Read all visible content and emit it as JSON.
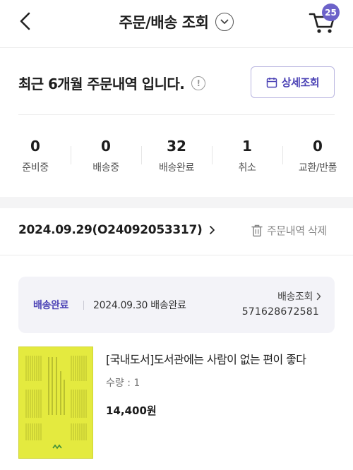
{
  "header": {
    "title": "주문/배송 조회",
    "cart_count": "25",
    "back_icon": "chevron-left-icon",
    "dropdown_icon": "chevron-down-icon",
    "cart_icon": "cart-icon"
  },
  "summary": {
    "title": "최근 6개월 주문내역 입니다.",
    "info_icon_glyph": "!",
    "detail_button_label": "상세조회",
    "detail_button_icon": "calendar-icon"
  },
  "stats": [
    {
      "count": "0",
      "label": "준비중"
    },
    {
      "count": "0",
      "label": "배송중"
    },
    {
      "count": "32",
      "label": "배송완료"
    },
    {
      "count": "1",
      "label": "취소"
    },
    {
      "count": "0",
      "label": "교환/반품"
    }
  ],
  "order": {
    "id_text": "2024.09.29(O24092053317)",
    "delete_label": "주문내역 삭제",
    "delivery": {
      "status": "배송완료",
      "date_text": "2024.09.30 배송완료",
      "tracking_label": "배송조회",
      "tracking_number": "571628672581"
    },
    "product": {
      "title": "[국내도서]도서관에는 사람이 없는 편이 좋다",
      "quantity_text": "수량 : 1",
      "price": "14,400원",
      "cover_color": "#e4ea3f"
    }
  },
  "colors": {
    "accent": "#4b42b5",
    "badge": "#6c62c9",
    "card_bg": "#f3f3f8"
  }
}
